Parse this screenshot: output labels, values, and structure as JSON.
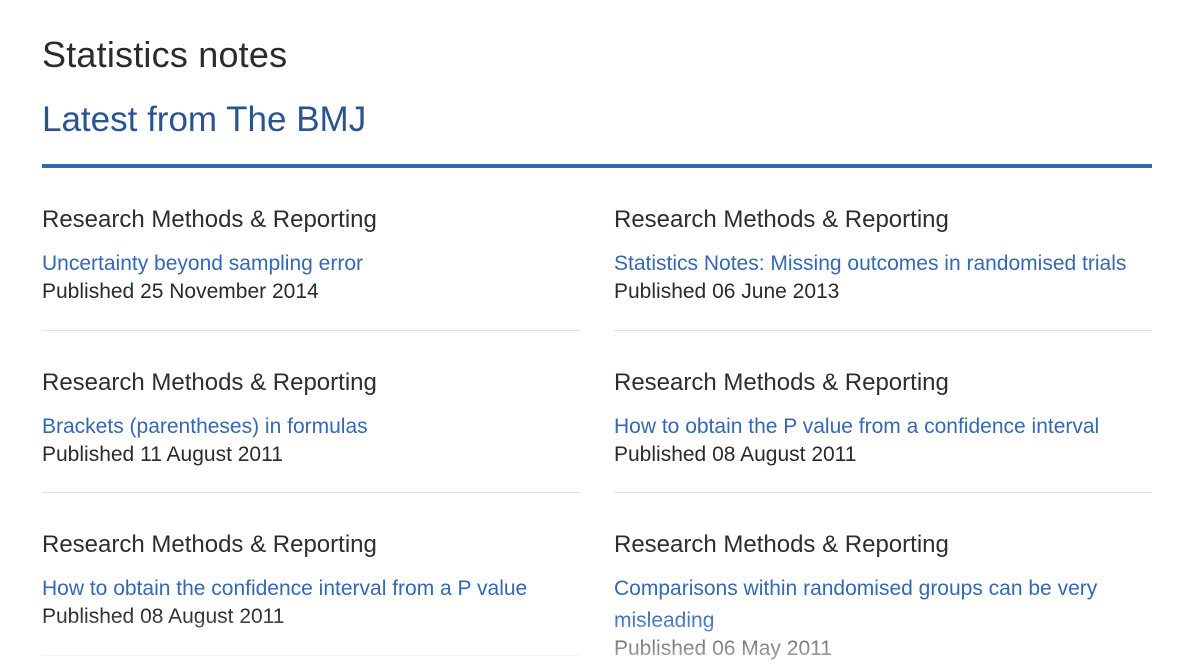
{
  "header": {
    "title": "Statistics notes",
    "section_title": "Latest from The BMJ"
  },
  "colors": {
    "accent": "#3a66b0",
    "link": "#3568b3",
    "section_title": "#2a5391"
  },
  "articles": {
    "left": [
      {
        "type": "Research Methods & Reporting",
        "title": "Uncertainty beyond sampling error",
        "date": "Published 25 November 2014"
      },
      {
        "type": "Research Methods & Reporting",
        "title": "Brackets (parentheses) in formulas",
        "date": "Published 11 August 2011"
      },
      {
        "type": "Research Methods & Reporting",
        "title": "How to obtain the confidence interval from a P value",
        "date": "Published 08 August 2011"
      }
    ],
    "right": [
      {
        "type": "Research Methods & Reporting",
        "title": "Statistics Notes: Missing outcomes in randomised trials",
        "date": "Published 06 June 2013"
      },
      {
        "type": "Research Methods & Reporting",
        "title": "How to obtain the P value from a confidence interval",
        "date": "Published 08 August 2011"
      },
      {
        "type": "Research Methods & Reporting",
        "title": "Comparisons within randomised groups can be very misleading",
        "date": "Published 06 May 2011"
      }
    ]
  }
}
